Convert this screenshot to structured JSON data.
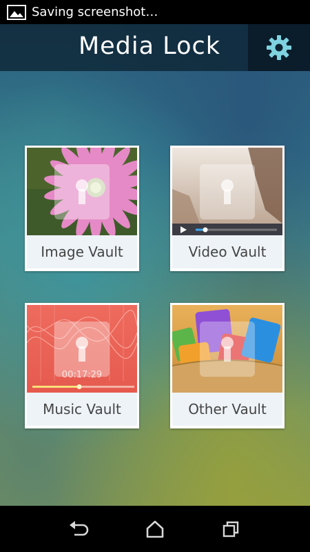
{
  "status_bar": {
    "icon": "image-icon",
    "text": "Saving screenshot…"
  },
  "header": {
    "title": "Media Lock",
    "settings_icon": "gear-icon"
  },
  "vaults": [
    {
      "label": "Image Vault",
      "icon": "flower-lock-image"
    },
    {
      "label": "Video Vault",
      "icon": "video-lock-image"
    },
    {
      "label": "Music Vault",
      "icon": "music-lock-image",
      "time": "00:17:29"
    },
    {
      "label": "Other Vault",
      "icon": "files-lock-image"
    }
  ],
  "nav": {
    "back_icon": "back-icon",
    "home_icon": "home-icon",
    "recents_icon": "recents-icon"
  },
  "colors": {
    "accent_dark": "#0a1e2d",
    "tile_label_bg": "#eef3f7"
  }
}
